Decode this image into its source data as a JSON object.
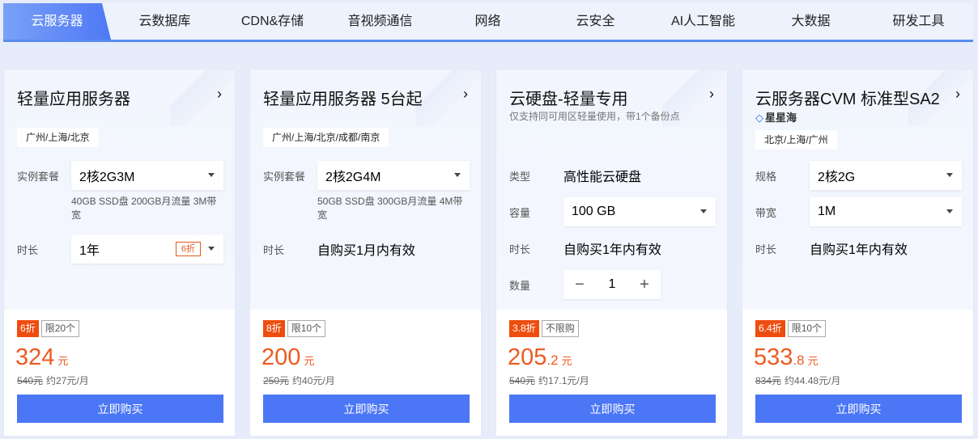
{
  "tabs": [
    "云服务器",
    "云数据库",
    "CDN&存储",
    "音视频通信",
    "网络",
    "云安全",
    "AI人工智能",
    "大数据",
    "研发工具"
  ],
  "active_tab": 0,
  "colors": {
    "accent": "#4b76f5",
    "price": "#ee5a21",
    "discount_bg": "#ee4d0f"
  },
  "cards": [
    {
      "title": "轻量应用服务器",
      "region": "广州/上海/北京",
      "rows": [
        {
          "label": "实例套餐",
          "type": "select",
          "value": "2核2G3M",
          "note": "40GB SSD盘 200GB月流量 3M带宽"
        },
        {
          "label": "时长",
          "type": "select",
          "value": "1年",
          "badge": "6折"
        }
      ],
      "discount": "6折",
      "limit": "限20个",
      "price_int": "324",
      "price_dec": "",
      "unit": "元",
      "original": "540元",
      "monthly": "约27元/月",
      "buy": "立即购买"
    },
    {
      "title": "轻量应用服务器 5台起",
      "region": "广州/上海/北京/成都/南京",
      "rows": [
        {
          "label": "实例套餐",
          "type": "select",
          "value": "2核2G4M",
          "note": "50GB SSD盘 300GB月流量 4M带宽"
        },
        {
          "label": "时长",
          "type": "text",
          "value": "自购买1月内有效"
        }
      ],
      "discount": "8折",
      "limit": "限10个",
      "price_int": "200",
      "price_dec": "",
      "unit": "元",
      "original": "250元",
      "monthly": "约40元/月",
      "buy": "立即购买"
    },
    {
      "title": "云硬盘-轻量专用",
      "subtitle": "仅支持同可用区轻量使用，带1个备份点",
      "rows": [
        {
          "label": "类型",
          "type": "text",
          "value": "高性能云硬盘"
        },
        {
          "label": "容量",
          "type": "select",
          "value": "100 GB"
        },
        {
          "label": "时长",
          "type": "text",
          "value": "自购买1年内有效"
        },
        {
          "label": "数量",
          "type": "stepper",
          "value": "1"
        }
      ],
      "discount": "3.8折",
      "limit": "不限购",
      "price_int": "205",
      "price_dec": ".2",
      "unit": "元",
      "original": "540元",
      "monthly": "约17.1元/月",
      "buy": "立即购买"
    },
    {
      "title": "云服务器CVM 标准型SA2",
      "brand": "星星海",
      "region": "北京/上海/广州",
      "rows": [
        {
          "label": "规格",
          "type": "select",
          "value": "2核2G"
        },
        {
          "label": "带宽",
          "type": "select",
          "value": "1M"
        },
        {
          "label": "时长",
          "type": "text",
          "value": "自购买1年内有效"
        }
      ],
      "discount": "6.4折",
      "limit": "限10个",
      "price_int": "533",
      "price_dec": ".8",
      "unit": "元",
      "original": "834元",
      "monthly": "约44.48元/月",
      "buy": "立即购买"
    }
  ]
}
